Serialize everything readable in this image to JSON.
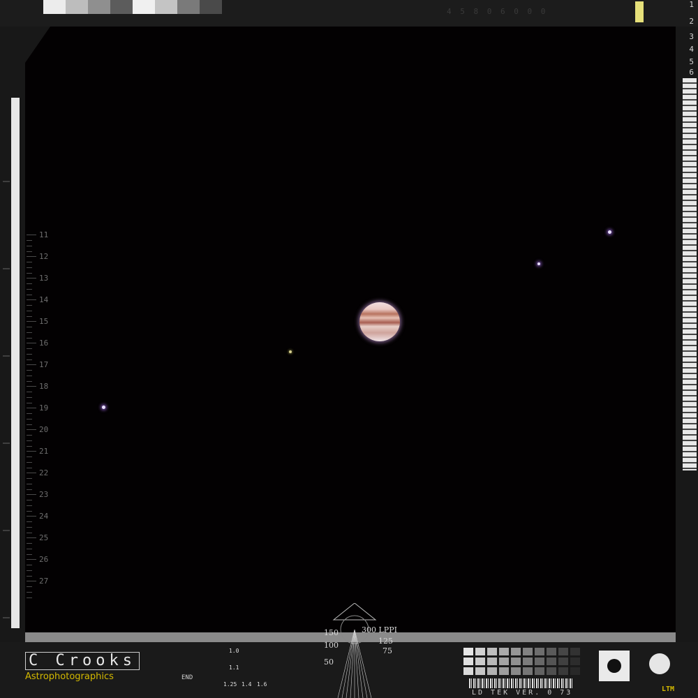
{
  "ruler_labels": [
    "11",
    "12",
    "13",
    "14",
    "15",
    "16",
    "17",
    "18",
    "19",
    "20",
    "21",
    "22",
    "23",
    "24",
    "25",
    "26",
    "27"
  ],
  "right_numbers": [
    "1",
    "2",
    "3",
    "4",
    "5",
    "6"
  ],
  "logo": {
    "name": "C Crooks",
    "subtitle": "Astrophotographics"
  },
  "lppi": {
    "center": "300 LPPI",
    "l150": "150",
    "l100": "100",
    "l50": "50",
    "r125": "125",
    "r75": "75"
  },
  "bottom_labels": {
    "end": "END",
    "version": "LD TEK VER. 0 73",
    "ltm": "LTM",
    "b10": "1.0",
    "b11": "1.1",
    "b125": "1.25",
    "b14": "1.4",
    "b16": "1.6"
  },
  "colors": {
    "accent_yellow": "#d4b900",
    "sky": "#030102",
    "frame": "#181818"
  }
}
